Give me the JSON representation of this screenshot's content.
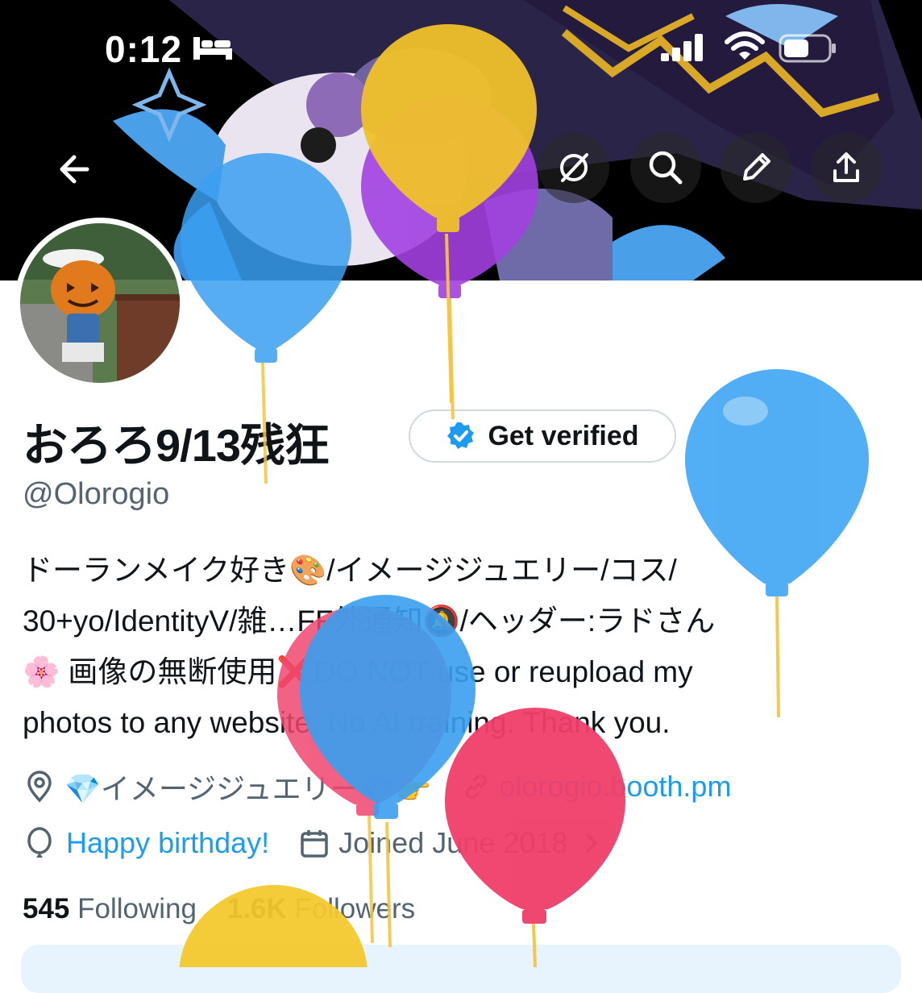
{
  "status_bar": {
    "time": "0:12"
  },
  "profile": {
    "name": "おろろ9/13残狂",
    "handle": "@Olorogio",
    "verify_button": "Get verified",
    "bio_lines": [
      "ドーランメイク好き🎨/イメージジュエリー/コス/",
      "30+yo/IdentityV/雑…FF外通知🔕/ヘッダー:ラドさん",
      "🌸 画像の無断使用❌DO NOT use or reupload my",
      "photos to any website. No AI training. Thank you."
    ],
    "location": "💎イメージジュエリー💎👉",
    "website": "olorogio.booth.pm",
    "birthday": "Happy birthday!",
    "joined": "Joined June 2018",
    "following_count": "545",
    "following_label": "Following",
    "followers_count": "1.6K",
    "followers_label": "Followers"
  },
  "colors": {
    "accent": "#1d9bf0",
    "secondary_text": "#536471",
    "verified": "#1d9bf0"
  }
}
